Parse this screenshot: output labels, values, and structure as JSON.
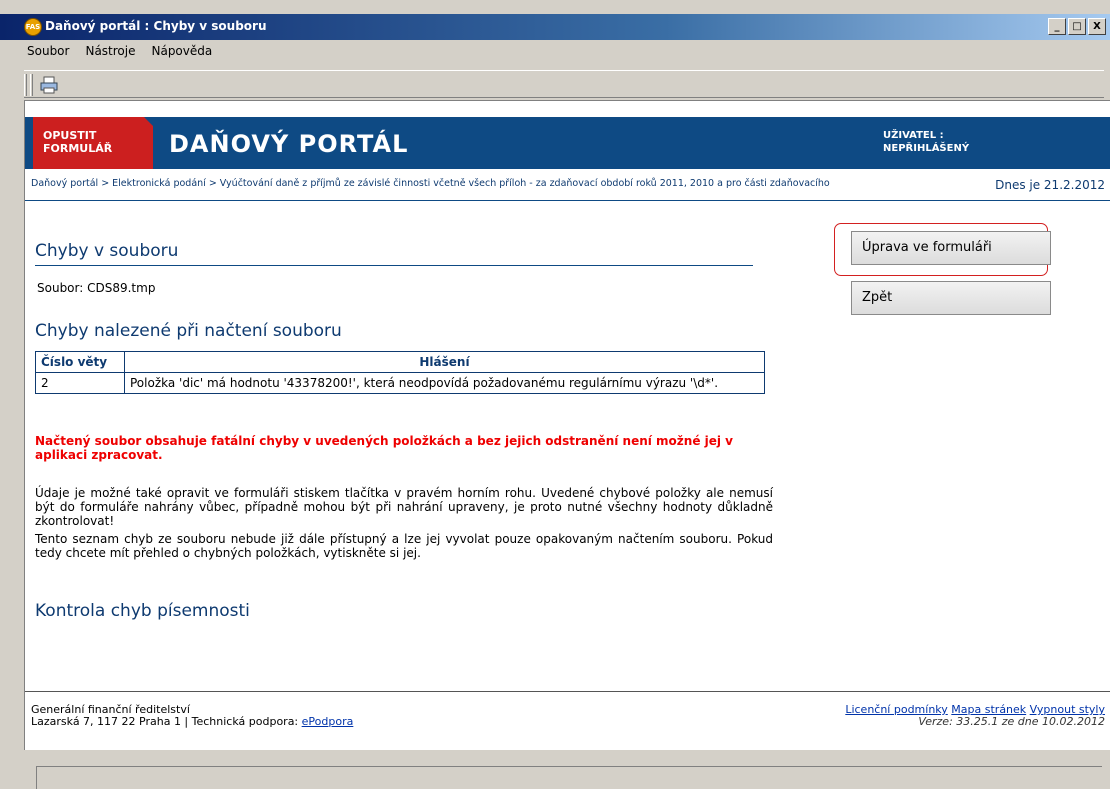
{
  "window": {
    "title": "Daňový portál : Chyby v souboru",
    "app_icon_text": "FAS",
    "controls": [
      "_",
      "□",
      "X"
    ]
  },
  "menu": [
    "Soubor",
    "Nástroje",
    "Nápověda"
  ],
  "toolbar": {
    "print_icon": "print-icon"
  },
  "header": {
    "exit_line1": "OPUSTIT",
    "exit_line2": "FORMULÁŘ",
    "brand": "DAŇOVÝ PORTÁL",
    "user_label": "UŽIVATEL :",
    "user_value": "NEPŘIHLÁŠENÝ"
  },
  "breadcrumb": {
    "path": "Daňový portál > Elektronická podání > Vyúčtování daně z příjmů ze závislé činnosti včetně všech příloh - za zdaňovací období roků 2011, 2010 a pro části zdaňovacího",
    "date": "Dnes je 21.2.2012"
  },
  "main": {
    "title": "Chyby v souboru",
    "file_label": "Soubor: CDS89.tmp",
    "found_title": "Chyby nalezené při načtení souboru",
    "table": {
      "headers": [
        "Číslo věty",
        "Hlášení"
      ],
      "rows": [
        [
          "2",
          "Položka 'dic' má hodnotu '43378200!', která neodpovídá požadovanému regulárnímu výrazu '\\d*'."
        ]
      ]
    },
    "fatal": "Načtený soubor obsahuje fatální chyby v uvedených položkách a bez jejich odstranění není možné jej v aplikaci zpracovat.",
    "info1": "Údaje je možné také opravit ve formuláři stiskem tlačítka v pravém horním rohu. Uvedené chybové položky ale nemusí být do formuláře nahrány vůbec, případně mohou být při nahrání upraveny, je proto nutné všechny hodnoty důkladně zkontrolovat!",
    "info2": "Tento seznam chyb ze souboru nebude již dále přístupný a lze jej vyvolat pouze opakovaným načtením souboru. Pokud tedy chcete mít přehled o chybných položkách, vytiskněte si jej.",
    "control_title": "Kontrola chyb písemnosti"
  },
  "buttons": {
    "edit": "Úprava ve formuláři",
    "back": "Zpět"
  },
  "footer": {
    "org": "Generální finanční ředitelství",
    "address": "Lazarská 7, 117 22 Praha 1 | Technická podpora: ",
    "support_link": "ePodpora",
    "link1": "Licenční podmínky",
    "link2": "Mapa stránek",
    "link3": "Vypnout styly",
    "version": "Verze: 33.25.1 ze dne 10.02.2012"
  }
}
